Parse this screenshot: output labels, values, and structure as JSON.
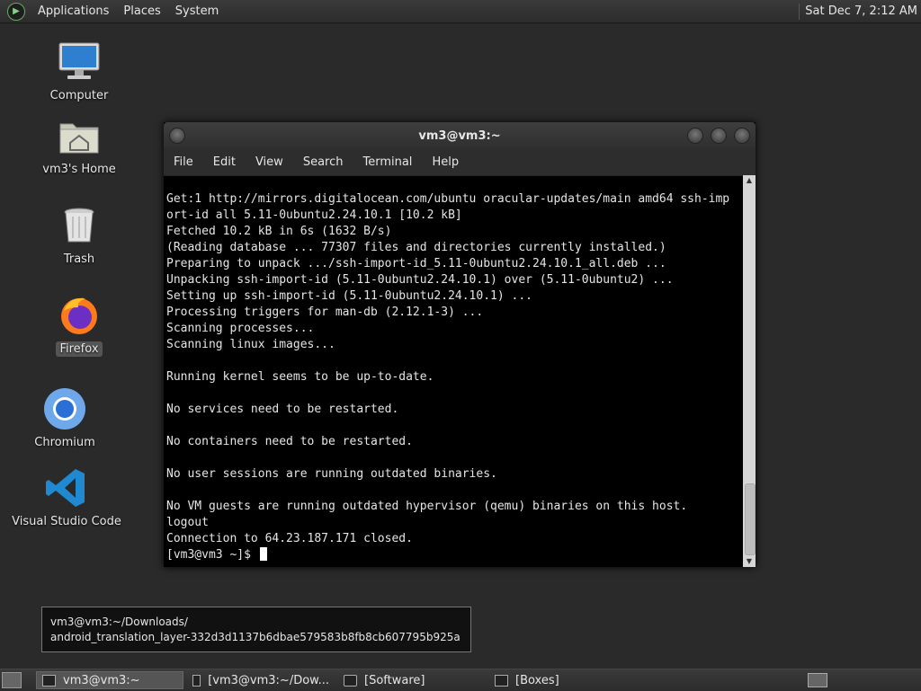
{
  "top_panel": {
    "menus": [
      "Applications",
      "Places",
      "System"
    ],
    "clock": "Sat Dec 7,  2:12 AM"
  },
  "desktop_icons": [
    {
      "label": "Computer",
      "icon": "computer-icon"
    },
    {
      "label": "vm3's Home",
      "icon": "home-folder-icon"
    },
    {
      "label": "Trash",
      "icon": "trash-icon"
    },
    {
      "label": "Firefox",
      "icon": "firefox-icon"
    },
    {
      "label": "Chromium",
      "icon": "chromium-icon"
    },
    {
      "label": "Visual Studio Code",
      "icon": "vscode-icon"
    }
  ],
  "terminal": {
    "title": "vm3@vm3:~",
    "menu": [
      "File",
      "Edit",
      "View",
      "Search",
      "Terminal",
      "Help"
    ],
    "lines": [
      "Get:1 http://mirrors.digitalocean.com/ubuntu oracular-updates/main amd64 ssh-imp",
      "ort-id all 5.11-0ubuntu2.24.10.1 [10.2 kB]",
      "Fetched 10.2 kB in 6s (1632 B/s)",
      "(Reading database ... 77307 files and directories currently installed.)",
      "Preparing to unpack .../ssh-import-id_5.11-0ubuntu2.24.10.1_all.deb ...",
      "Unpacking ssh-import-id (5.11-0ubuntu2.24.10.1) over (5.11-0ubuntu2) ...",
      "Setting up ssh-import-id (5.11-0ubuntu2.24.10.1) ...",
      "Processing triggers for man-db (2.12.1-3) ...",
      "Scanning processes...",
      "Scanning linux images...",
      "",
      "Running kernel seems to be up-to-date.",
      "",
      "No services need to be restarted.",
      "",
      "No containers need to be restarted.",
      "",
      "No user sessions are running outdated binaries.",
      "",
      "No VM guests are running outdated hypervisor (qemu) binaries on this host.",
      "logout",
      "Connection to 64.23.187.171 closed."
    ],
    "prompt": "[vm3@vm3 ~]$ "
  },
  "tooltip": {
    "line1": "vm3@vm3:~/Downloads/",
    "line2": "android_translation_layer-332d3d1137b6dbae579583b8fb8cb607795b925a"
  },
  "taskbar": {
    "items": [
      {
        "label": "vm3@vm3:~",
        "active": true
      },
      {
        "label": "[vm3@vm3:~/Dow...",
        "active": false
      },
      {
        "label": "[Software]",
        "active": false
      },
      {
        "label": "[Boxes]",
        "active": false
      }
    ]
  }
}
